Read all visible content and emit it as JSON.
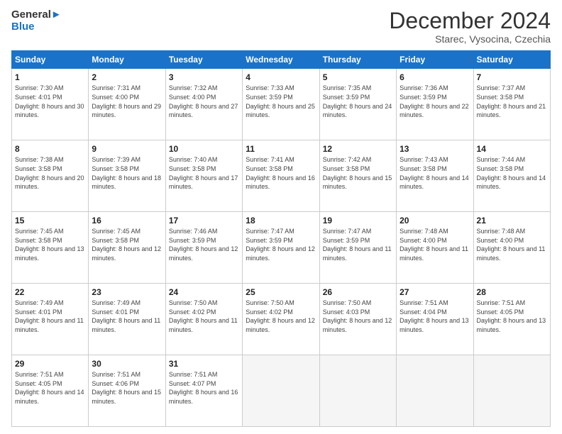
{
  "logo": {
    "line1": "General",
    "line2": "Blue"
  },
  "header": {
    "month": "December 2024",
    "location": "Starec, Vysocina, Czechia"
  },
  "days_of_week": [
    "Sunday",
    "Monday",
    "Tuesday",
    "Wednesday",
    "Thursday",
    "Friday",
    "Saturday"
  ],
  "weeks": [
    [
      {
        "day": "1",
        "sunrise": "7:30 AM",
        "sunset": "4:01 PM",
        "daylight": "8 hours and 30 minutes."
      },
      {
        "day": "2",
        "sunrise": "7:31 AM",
        "sunset": "4:00 PM",
        "daylight": "8 hours and 29 minutes."
      },
      {
        "day": "3",
        "sunrise": "7:32 AM",
        "sunset": "4:00 PM",
        "daylight": "8 hours and 27 minutes."
      },
      {
        "day": "4",
        "sunrise": "7:33 AM",
        "sunset": "3:59 PM",
        "daylight": "8 hours and 25 minutes."
      },
      {
        "day": "5",
        "sunrise": "7:35 AM",
        "sunset": "3:59 PM",
        "daylight": "8 hours and 24 minutes."
      },
      {
        "day": "6",
        "sunrise": "7:36 AM",
        "sunset": "3:59 PM",
        "daylight": "8 hours and 22 minutes."
      },
      {
        "day": "7",
        "sunrise": "7:37 AM",
        "sunset": "3:58 PM",
        "daylight": "8 hours and 21 minutes."
      }
    ],
    [
      {
        "day": "8",
        "sunrise": "7:38 AM",
        "sunset": "3:58 PM",
        "daylight": "8 hours and 20 minutes."
      },
      {
        "day": "9",
        "sunrise": "7:39 AM",
        "sunset": "3:58 PM",
        "daylight": "8 hours and 18 minutes."
      },
      {
        "day": "10",
        "sunrise": "7:40 AM",
        "sunset": "3:58 PM",
        "daylight": "8 hours and 17 minutes."
      },
      {
        "day": "11",
        "sunrise": "7:41 AM",
        "sunset": "3:58 PM",
        "daylight": "8 hours and 16 minutes."
      },
      {
        "day": "12",
        "sunrise": "7:42 AM",
        "sunset": "3:58 PM",
        "daylight": "8 hours and 15 minutes."
      },
      {
        "day": "13",
        "sunrise": "7:43 AM",
        "sunset": "3:58 PM",
        "daylight": "8 hours and 14 minutes."
      },
      {
        "day": "14",
        "sunrise": "7:44 AM",
        "sunset": "3:58 PM",
        "daylight": "8 hours and 14 minutes."
      }
    ],
    [
      {
        "day": "15",
        "sunrise": "7:45 AM",
        "sunset": "3:58 PM",
        "daylight": "8 hours and 13 minutes."
      },
      {
        "day": "16",
        "sunrise": "7:45 AM",
        "sunset": "3:58 PM",
        "daylight": "8 hours and 12 minutes."
      },
      {
        "day": "17",
        "sunrise": "7:46 AM",
        "sunset": "3:59 PM",
        "daylight": "8 hours and 12 minutes."
      },
      {
        "day": "18",
        "sunrise": "7:47 AM",
        "sunset": "3:59 PM",
        "daylight": "8 hours and 12 minutes."
      },
      {
        "day": "19",
        "sunrise": "7:47 AM",
        "sunset": "3:59 PM",
        "daylight": "8 hours and 11 minutes."
      },
      {
        "day": "20",
        "sunrise": "7:48 AM",
        "sunset": "4:00 PM",
        "daylight": "8 hours and 11 minutes."
      },
      {
        "day": "21",
        "sunrise": "7:48 AM",
        "sunset": "4:00 PM",
        "daylight": "8 hours and 11 minutes."
      }
    ],
    [
      {
        "day": "22",
        "sunrise": "7:49 AM",
        "sunset": "4:01 PM",
        "daylight": "8 hours and 11 minutes."
      },
      {
        "day": "23",
        "sunrise": "7:49 AM",
        "sunset": "4:01 PM",
        "daylight": "8 hours and 11 minutes."
      },
      {
        "day": "24",
        "sunrise": "7:50 AM",
        "sunset": "4:02 PM",
        "daylight": "8 hours and 11 minutes."
      },
      {
        "day": "25",
        "sunrise": "7:50 AM",
        "sunset": "4:02 PM",
        "daylight": "8 hours and 12 minutes."
      },
      {
        "day": "26",
        "sunrise": "7:50 AM",
        "sunset": "4:03 PM",
        "daylight": "8 hours and 12 minutes."
      },
      {
        "day": "27",
        "sunrise": "7:51 AM",
        "sunset": "4:04 PM",
        "daylight": "8 hours and 13 minutes."
      },
      {
        "day": "28",
        "sunrise": "7:51 AM",
        "sunset": "4:05 PM",
        "daylight": "8 hours and 13 minutes."
      }
    ],
    [
      {
        "day": "29",
        "sunrise": "7:51 AM",
        "sunset": "4:05 PM",
        "daylight": "8 hours and 14 minutes."
      },
      {
        "day": "30",
        "sunrise": "7:51 AM",
        "sunset": "4:06 PM",
        "daylight": "8 hours and 15 minutes."
      },
      {
        "day": "31",
        "sunrise": "7:51 AM",
        "sunset": "4:07 PM",
        "daylight": "8 hours and 16 minutes."
      },
      null,
      null,
      null,
      null
    ]
  ]
}
